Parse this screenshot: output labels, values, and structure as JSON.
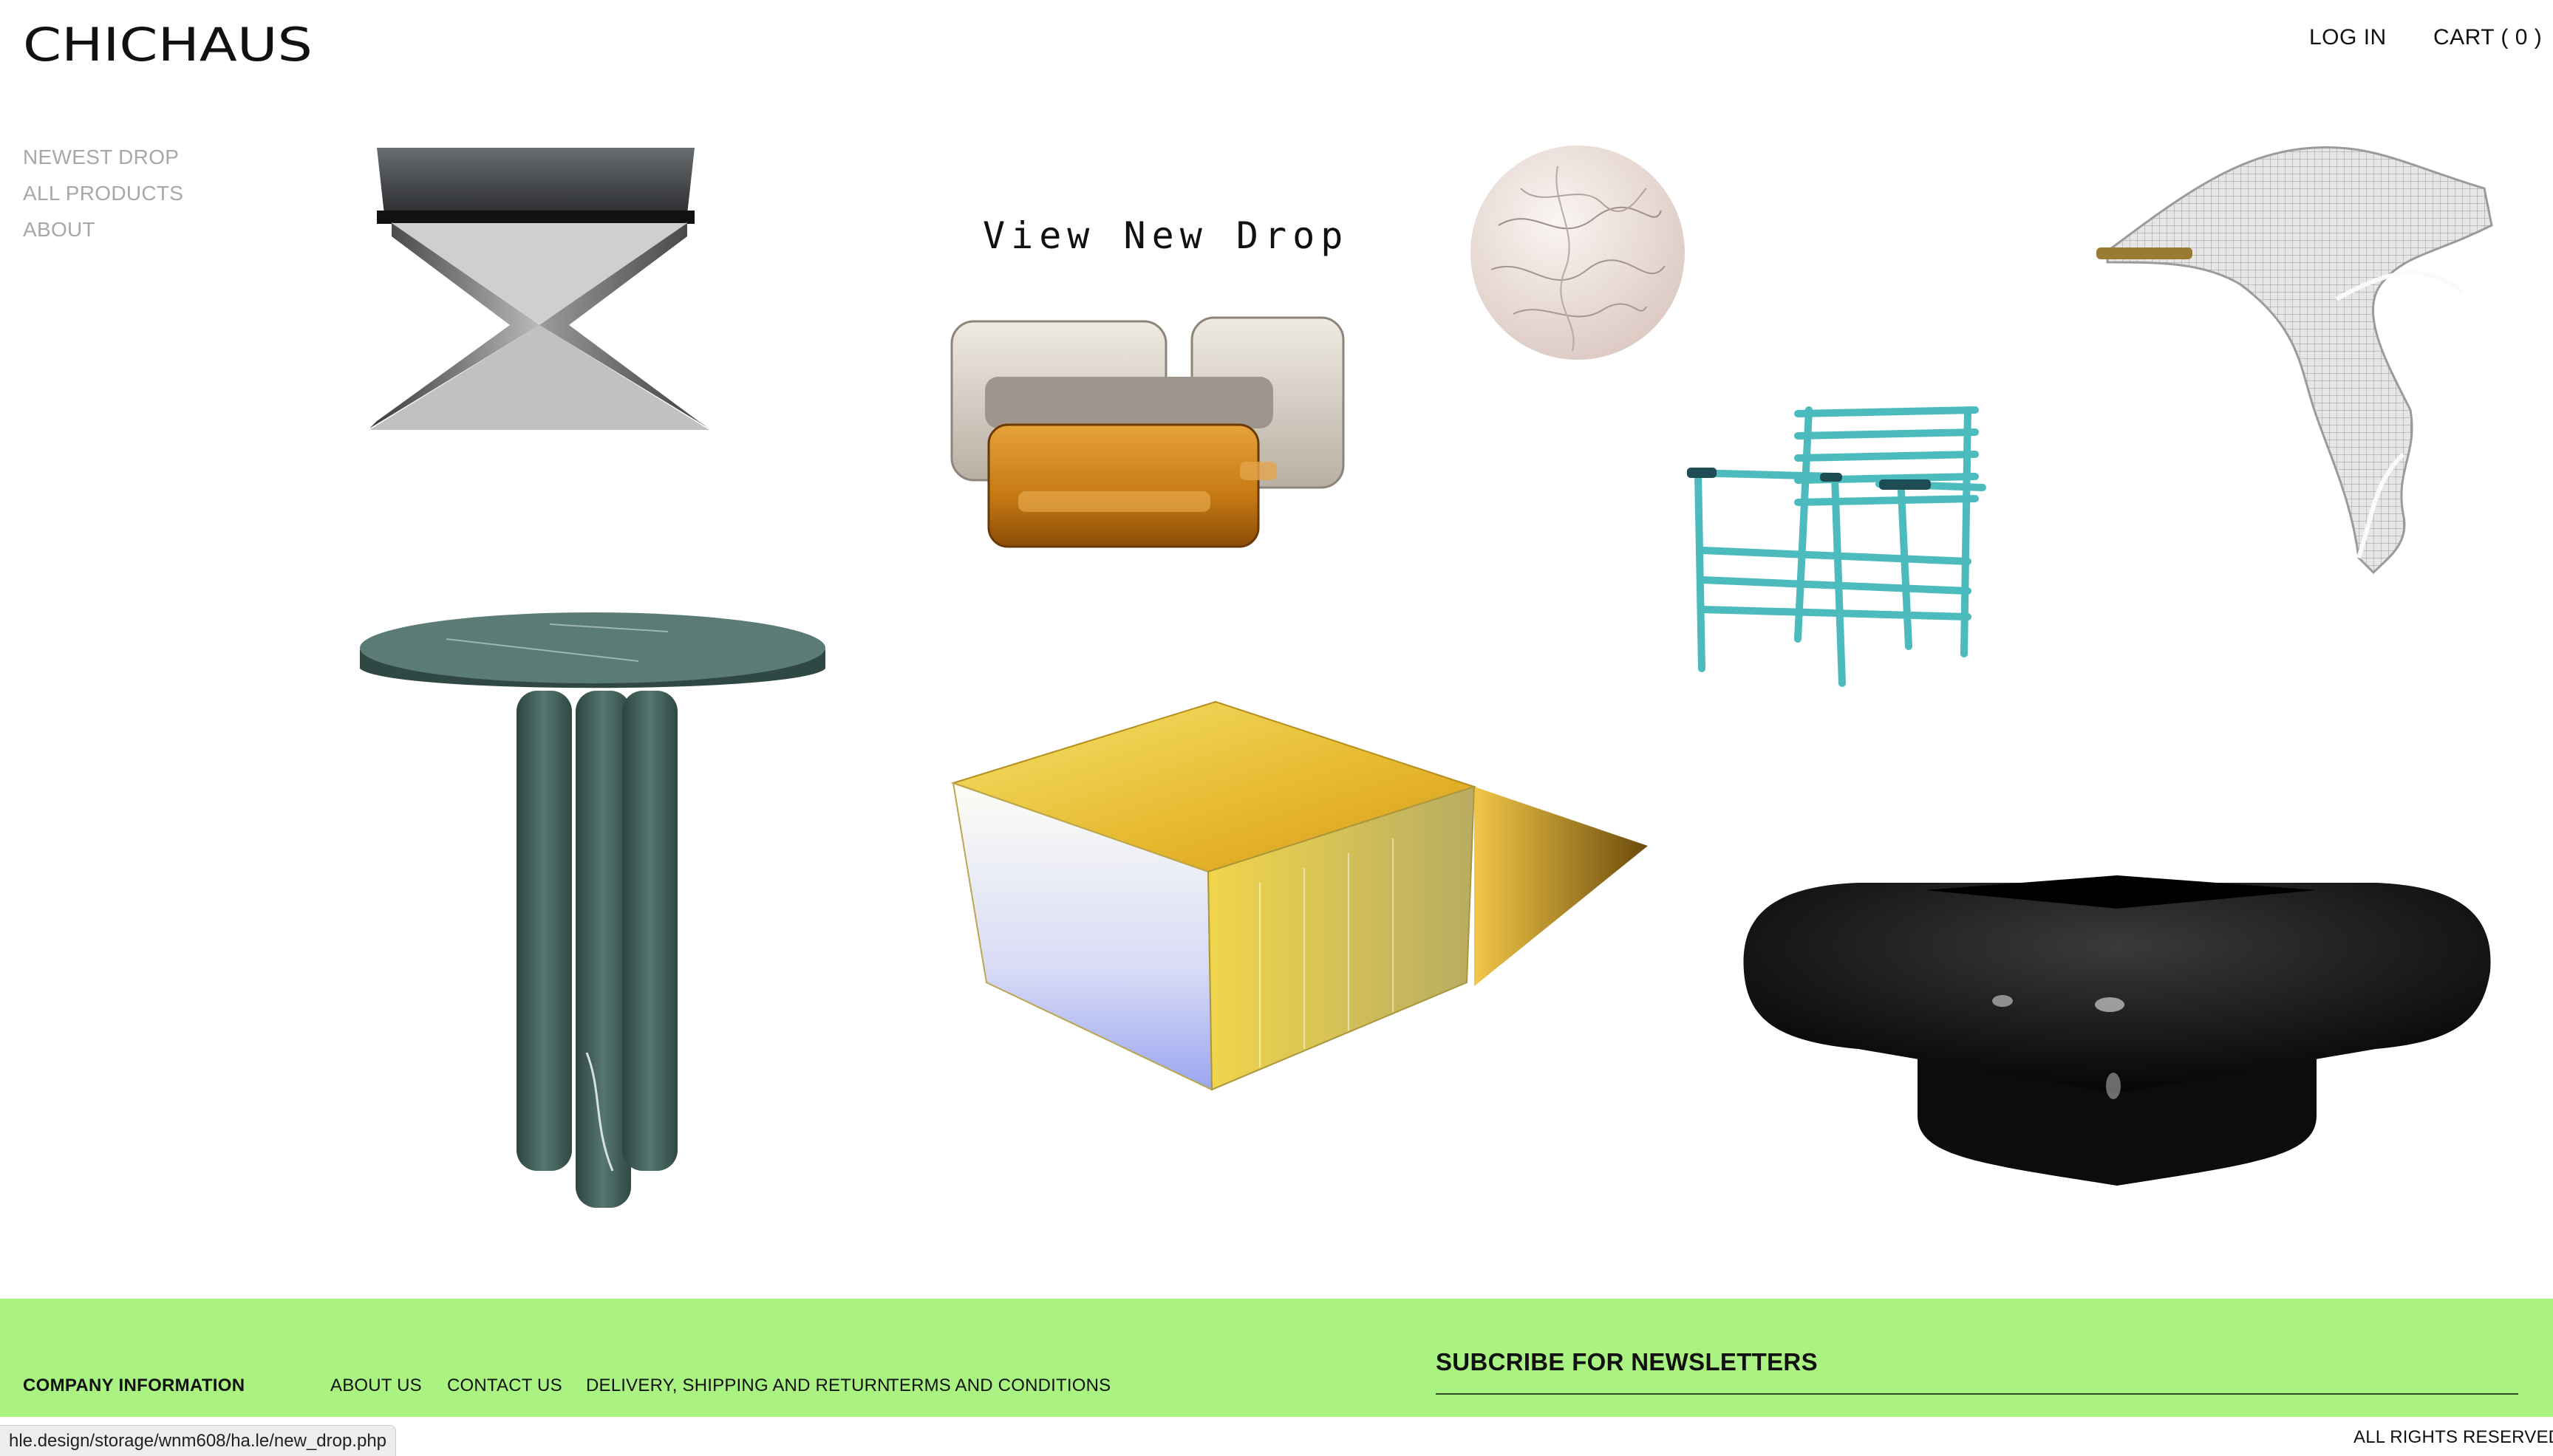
{
  "brand": {
    "logo_text": "CHICHAUS"
  },
  "header": {
    "login_label": "LOG IN",
    "cart_label": "CART ( 0 )"
  },
  "side_nav": {
    "items": [
      {
        "label": "NEWEST DROP"
      },
      {
        "label": "ALL PRODUCTS"
      },
      {
        "label": "ABOUT"
      }
    ]
  },
  "hero": {
    "view_drop_label": "View New Drop"
  },
  "products": [
    {
      "name": "x-stool",
      "color": "#4a4a4a"
    },
    {
      "name": "glass-block-sofa",
      "color": "#c8841a"
    },
    {
      "name": "paper-sphere-lamp",
      "color": "#efe6e2"
    },
    {
      "name": "mesh-curve-chair",
      "color": "#cfcfcf"
    },
    {
      "name": "green-marble-side-table",
      "color": "#3f5c57"
    },
    {
      "name": "acid-glass-chair",
      "color": "#5cc8c8"
    },
    {
      "name": "iridescent-glass-table",
      "color": "#e9cd48"
    },
    {
      "name": "black-lacquer-table",
      "color": "#111111"
    }
  ],
  "footer": {
    "background": "#aaf382",
    "company_title": "COMPANY INFORMATION",
    "links": [
      {
        "label": "ABOUT US"
      },
      {
        "label": "CONTACT US"
      },
      {
        "label": "DELIVERY, SHIPPING AND RETURN"
      },
      {
        "label": "TERMS AND CONDITIONS"
      }
    ],
    "newsletter_title": "SUBCRIBE FOR NEWSLETTERS",
    "rights": "ALL RIGHTS RESERVED"
  },
  "status_bar": {
    "url": "hle.design/storage/wnm608/ha.le/new_drop.php"
  }
}
